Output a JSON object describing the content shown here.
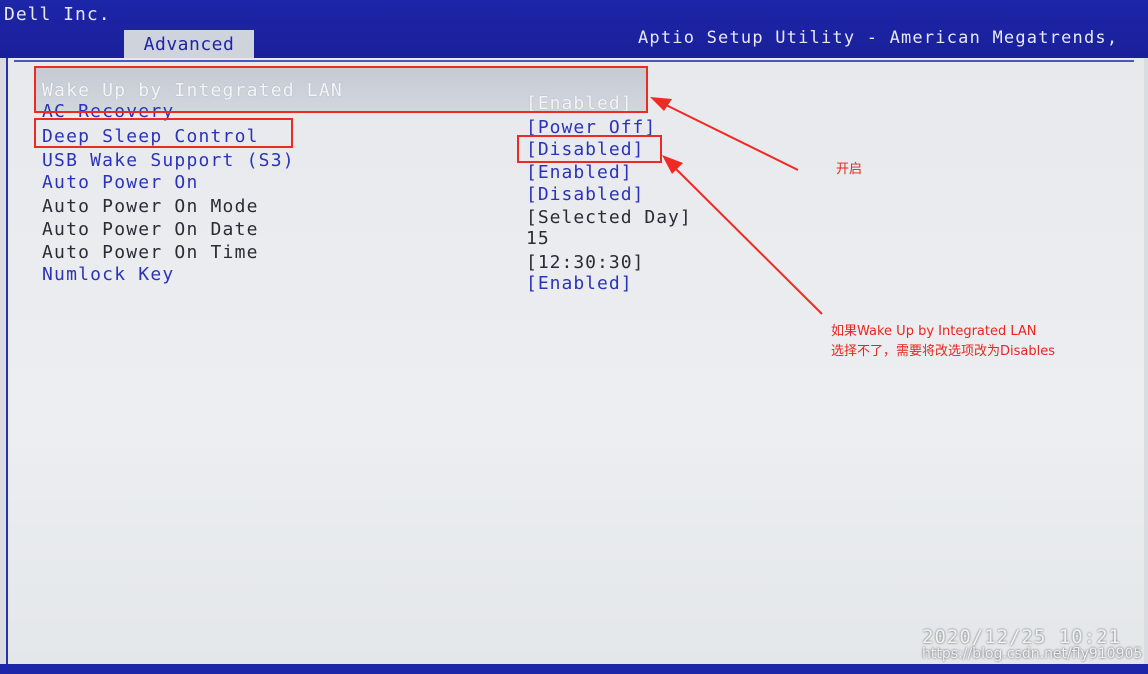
{
  "header": {
    "vendor": "Dell Inc.",
    "active_tab": "Advanced",
    "utility_title": "Aptio Setup Utility - American Megatrends,"
  },
  "settings": [
    {
      "label": "Wake Up by Integrated LAN",
      "value": "[Enabled]"
    },
    {
      "label": "AC Recovery",
      "value": "[Power Off]"
    },
    {
      "label": "Deep Sleep Control",
      "value": "[Disabled]"
    },
    {
      "label": "USB Wake Support (S3)",
      "value": "[Enabled]"
    },
    {
      "label": "Auto Power On",
      "value": "[Disabled]"
    },
    {
      "label": "Auto Power On Mode",
      "value": "[Selected Day]"
    },
    {
      "label": "Auto Power On Date",
      "value": "15"
    },
    {
      "label": "Auto Power On Time",
      "value": "[12:30:30]"
    },
    {
      "label": "Numlock Key",
      "value": "[Enabled]"
    }
  ],
  "annotations": {
    "enable_note": "开启",
    "hint_line1": "如果Wake Up by Integrated LAN",
    "hint_line2": "选择不了，需要将改选项改为Disables"
  },
  "photo": {
    "timestamp": "2020/12/25 10:21",
    "watermark": "https://blog.csdn.net/fly910905"
  },
  "colors": {
    "bios_blue": "#1d25a8",
    "annotation_red": "#ee2a22"
  }
}
